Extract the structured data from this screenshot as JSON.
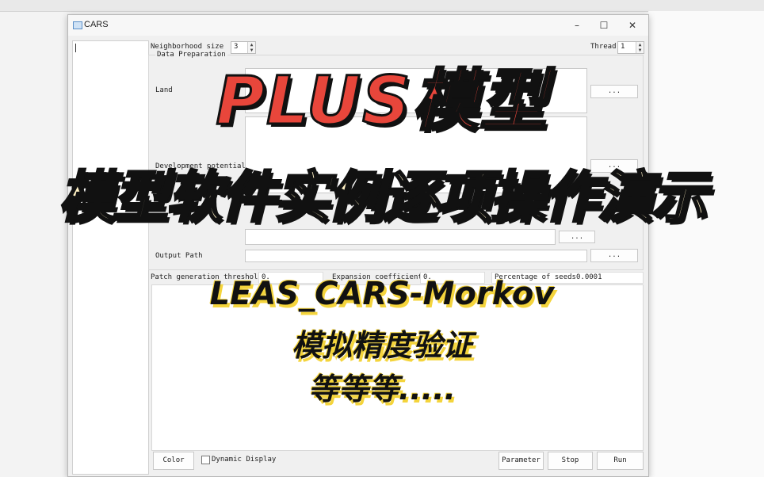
{
  "window": {
    "title": "CARS"
  },
  "params": {
    "neighborhood_label": "Neighborhood size",
    "neighborhood_value": "3",
    "thread_label": "Thread",
    "thread_value": "1"
  },
  "data_prep": {
    "group_label": "Data Preparation",
    "land_label": "Land",
    "dev_potential_label": "Development potential",
    "output_label": "Output Path",
    "browse_label": "..."
  },
  "coefficients": {
    "patch_label": "Patch generation threshold",
    "patch_value": "0.",
    "expansion_label": "Expansion coefficient",
    "expansion_value": "0.",
    "seeds_label": "Percentage of seeds",
    "seeds_value": "0.0001"
  },
  "buttons": {
    "color": "Color",
    "dynamic_display": "Dynamic Display",
    "parameter": "Parameter",
    "stop": "Stop",
    "run": "Run"
  },
  "overlay": {
    "title": "PLUS模型",
    "subtitle": "模型软件实例逐项操作演示",
    "line1": "LEAS_CARS-Morkov",
    "line2": "模拟精度验证",
    "line3": "等等等....."
  },
  "colors": {
    "title_red": "#e8463b",
    "subtitle_cream": "#fff1c4",
    "highlight_yellow": "#f4d43c"
  }
}
